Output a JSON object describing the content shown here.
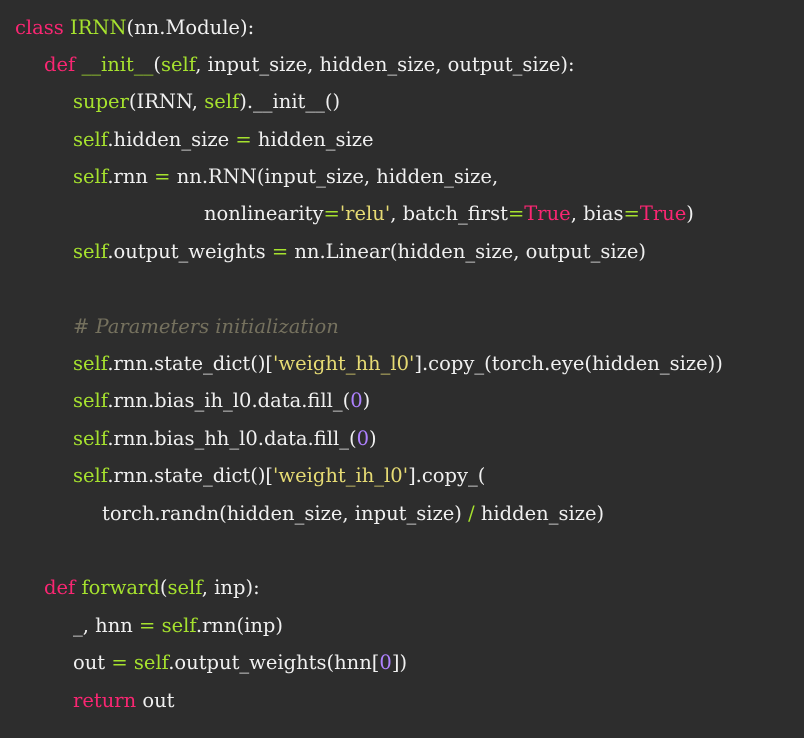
{
  "code": {
    "lines": [
      [
        {
          "t": "kw",
          "v": "class "
        },
        {
          "t": "cls",
          "v": "IRNN"
        },
        {
          "t": "plain",
          "v": "(nn.Module):"
        }
      ],
      [
        {
          "t": "kw",
          "v": "def "
        },
        {
          "t": "cls",
          "v": "__init__"
        },
        {
          "t": "plain",
          "v": "("
        },
        {
          "t": "self",
          "v": "self"
        },
        {
          "t": "plain",
          "v": ", input_size, hidden_size, output_size):"
        }
      ],
      [
        {
          "t": "self",
          "v": "super"
        },
        {
          "t": "plain",
          "v": "(IRNN, "
        },
        {
          "t": "self",
          "v": "self"
        },
        {
          "t": "plain",
          "v": ").__init__()"
        }
      ],
      [
        {
          "t": "self",
          "v": "self"
        },
        {
          "t": "plain",
          "v": ".hidden_size "
        },
        {
          "t": "op2",
          "v": "="
        },
        {
          "t": "plain",
          "v": " hidden_size"
        }
      ],
      [
        {
          "t": "self",
          "v": "self"
        },
        {
          "t": "plain",
          "v": ".rnn "
        },
        {
          "t": "op2",
          "v": "="
        },
        {
          "t": "plain",
          "v": " nn.RNN(input_size, hidden_size,"
        }
      ],
      [
        {
          "t": "plain",
          "v": "nonlinearity"
        },
        {
          "t": "op2",
          "v": "="
        },
        {
          "t": "str",
          "v": "'relu'"
        },
        {
          "t": "plain",
          "v": ", batch_first"
        },
        {
          "t": "op2",
          "v": "="
        },
        {
          "t": "kw",
          "v": "True"
        },
        {
          "t": "plain",
          "v": ", bias"
        },
        {
          "t": "op2",
          "v": "="
        },
        {
          "t": "kw",
          "v": "True"
        },
        {
          "t": "plain",
          "v": ")"
        }
      ],
      [
        {
          "t": "self",
          "v": "self"
        },
        {
          "t": "plain",
          "v": ".output_weights "
        },
        {
          "t": "op2",
          "v": "="
        },
        {
          "t": "plain",
          "v": " nn.Linear(hidden_size, output_size)"
        }
      ],
      [],
      [
        {
          "t": "com",
          "v": "# Parameters initialization"
        }
      ],
      [
        {
          "t": "self",
          "v": "self"
        },
        {
          "t": "plain",
          "v": ".rnn.state_dict()["
        },
        {
          "t": "str",
          "v": "'weight_hh_l0'"
        },
        {
          "t": "plain",
          "v": "].copy_(torch.eye(hidden_size))"
        }
      ],
      [
        {
          "t": "self",
          "v": "self"
        },
        {
          "t": "plain",
          "v": ".rnn.bias_ih_l0.data.fill_("
        },
        {
          "t": "num",
          "v": "0"
        },
        {
          "t": "plain",
          "v": ")"
        }
      ],
      [
        {
          "t": "self",
          "v": "self"
        },
        {
          "t": "plain",
          "v": ".rnn.bias_hh_l0.data.fill_("
        },
        {
          "t": "num",
          "v": "0"
        },
        {
          "t": "plain",
          "v": ")"
        }
      ],
      [
        {
          "t": "self",
          "v": "self"
        },
        {
          "t": "plain",
          "v": ".rnn.state_dict()["
        },
        {
          "t": "str",
          "v": "'weight_ih_l0'"
        },
        {
          "t": "plain",
          "v": "].copy_("
        }
      ],
      [
        {
          "t": "plain",
          "v": "torch.randn(hidden_size, input_size) "
        },
        {
          "t": "op2",
          "v": "/"
        },
        {
          "t": "plain",
          "v": " hidden_size)"
        }
      ],
      [],
      [
        {
          "t": "kw",
          "v": "def "
        },
        {
          "t": "cls",
          "v": "forward"
        },
        {
          "t": "plain",
          "v": "("
        },
        {
          "t": "self",
          "v": "self"
        },
        {
          "t": "plain",
          "v": ", inp):"
        }
      ],
      [
        {
          "t": "plain",
          "v": "_, hnn "
        },
        {
          "t": "op2",
          "v": "="
        },
        {
          "t": "plain",
          "v": " "
        },
        {
          "t": "self",
          "v": "self"
        },
        {
          "t": "plain",
          "v": ".rnn(inp)"
        }
      ],
      [
        {
          "t": "plain",
          "v": "out "
        },
        {
          "t": "op2",
          "v": "="
        },
        {
          "t": "plain",
          "v": " "
        },
        {
          "t": "self",
          "v": "self"
        },
        {
          "t": "plain",
          "v": ".output_weights(hnn["
        },
        {
          "t": "num",
          "v": "0"
        },
        {
          "t": "plain",
          "v": "])"
        }
      ],
      [
        {
          "t": "kw",
          "v": "return "
        },
        {
          "t": "plain",
          "v": "out"
        }
      ]
    ]
  },
  "colors": {
    "background": "#2d2d2d",
    "keyword": "#f92672",
    "class_name": "#a6e22e",
    "self": "#a6e22e",
    "string": "#e6db74",
    "number": "#ae81ff",
    "comment": "#75715e",
    "text": "#f0f0f0"
  }
}
